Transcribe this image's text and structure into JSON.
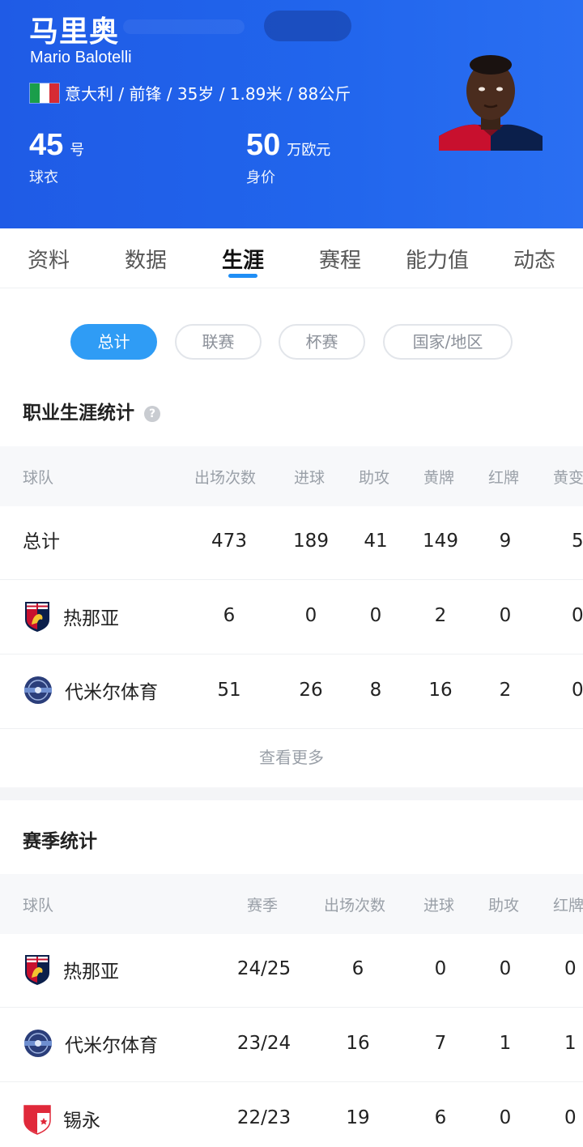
{
  "player": {
    "name_cn": "马里奥",
    "name_en": "Mario Balotelli",
    "meta": "意大利 / 前锋 / 35岁 / 1.89米 / 88公斤",
    "jersey_number": "45",
    "jersey_unit": "号",
    "jersey_caption": "球衣",
    "value_number": "50",
    "value_unit": "万欧元",
    "value_caption": "身价"
  },
  "tabs": [
    "资料",
    "数据",
    "生涯",
    "赛程",
    "能力值",
    "动态"
  ],
  "active_tab": "生涯",
  "filters": [
    "总计",
    "联赛",
    "杯赛",
    "国家/地区"
  ],
  "active_filter": "总计",
  "career": {
    "title": "职业生涯统计",
    "help_icon": "?",
    "headers": [
      "球队",
      "出场次数",
      "进球",
      "助攻",
      "黄牌",
      "红牌",
      "黄变"
    ],
    "rows": [
      {
        "team": "总计",
        "apps": "473",
        "goals": "189",
        "assists": "41",
        "yellow": "149",
        "red": "9",
        "y2r": "5"
      },
      {
        "team": "热那亚",
        "apps": "6",
        "goals": "0",
        "assists": "0",
        "yellow": "2",
        "red": "0",
        "y2r": "0"
      },
      {
        "team": "代米尔体育",
        "apps": "51",
        "goals": "26",
        "assists": "8",
        "yellow": "16",
        "red": "2",
        "y2r": "0"
      }
    ],
    "more": "查看更多"
  },
  "season": {
    "title": "赛季统计",
    "headers": [
      "球队",
      "赛季",
      "出场次数",
      "进球",
      "助攻",
      "红牌"
    ],
    "rows": [
      {
        "team": "热那亚",
        "season": "24/25",
        "apps": "6",
        "goals": "0",
        "assists": "0",
        "red": "0"
      },
      {
        "team": "代米尔体育",
        "season": "23/24",
        "apps": "16",
        "goals": "7",
        "assists": "1",
        "red": "1"
      },
      {
        "team": "锡永",
        "season": "22/23",
        "apps": "19",
        "goals": "6",
        "assists": "0",
        "red": "0"
      }
    ]
  },
  "colors": {
    "header_blue": "#2165ec",
    "accent": "#2f9cf5",
    "genoa_red": "#c8102e",
    "genoa_navy": "#0b1f4b"
  }
}
